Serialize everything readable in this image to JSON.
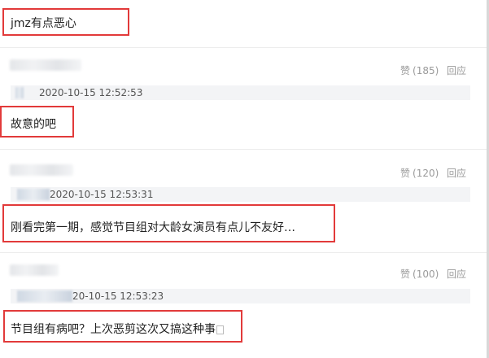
{
  "comments": [
    {
      "text": "jmz有点恶心",
      "like_label": "",
      "like_count": "",
      "reply_label": "",
      "timestamp": ""
    },
    {
      "text": "故意的吧",
      "like_label": "赞",
      "like_count": "(185)",
      "reply_label": "回应",
      "timestamp": "2020-10-15 12:52:53"
    },
    {
      "text": "刚看完第一期，感觉节目组对大龄女演员有点儿不友好…",
      "like_label": "赞",
      "like_count": "(120)",
      "reply_label": "回应",
      "timestamp": "2020-10-15 12:53:31"
    },
    {
      "text": "节目组有病吧？上次恶剪这次又搞这种事",
      "like_label": "赞",
      "like_count": "(100)",
      "reply_label": "回应",
      "timestamp": "20-10-15 12:53:23"
    }
  ],
  "colors": {
    "highlight": "#e23a3a",
    "meta_bar": "#f3f4f6",
    "action_text": "#9a9a9a"
  }
}
